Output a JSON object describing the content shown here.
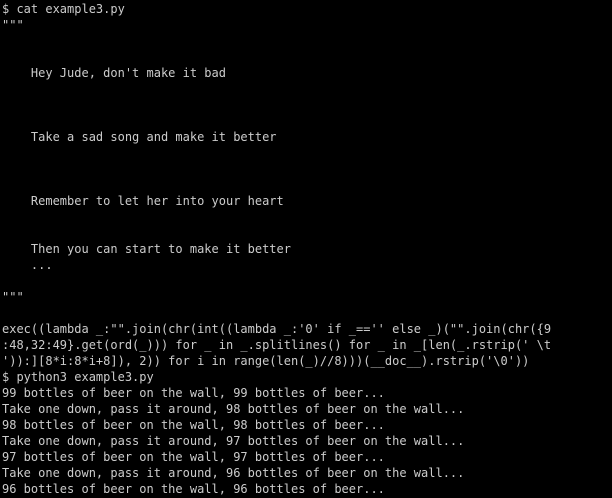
{
  "terminal": {
    "cmd1": "$ cat example3.py",
    "open_quotes": "\"\"\"",
    "lyric1": "    Hey Jude, don't make it bad",
    "lyric2": "    Take a sad song and make it better",
    "lyric3": "    Remember to let her into your heart",
    "lyric4": "    Then you can start to make it better",
    "lyric5": "    ...",
    "close_quotes": "\"\"\"",
    "exec1": "exec((lambda _:\"\".join(chr(int((lambda _:'0' if _=='' else _)(\"\".join(chr({9",
    "exec2": ":48,32:49}.get(ord(_))) for _ in _.splitlines() for _ in _[len(_.rstrip(' \\t",
    "exec3": "')):][8*i:8*i+8]), 2)) for i in range(len(_)//8)))(__doc__).rstrip('\\0'))",
    "cmd2": "$ python3 example3.py",
    "out1": "99 bottles of beer on the wall, 99 bottles of beer...",
    "out2": "Take one down, pass it around, 98 bottles of beer on the wall...",
    "out3": "98 bottles of beer on the wall, 98 bottles of beer...",
    "out4": "Take one down, pass it around, 97 bottles of beer on the wall...",
    "out5": "97 bottles of beer on the wall, 97 bottles of beer...",
    "out6": "Take one down, pass it around, 96 bottles of beer on the wall...",
    "out7": "96 bottles of beer on the wall, 96 bottles of beer..."
  }
}
